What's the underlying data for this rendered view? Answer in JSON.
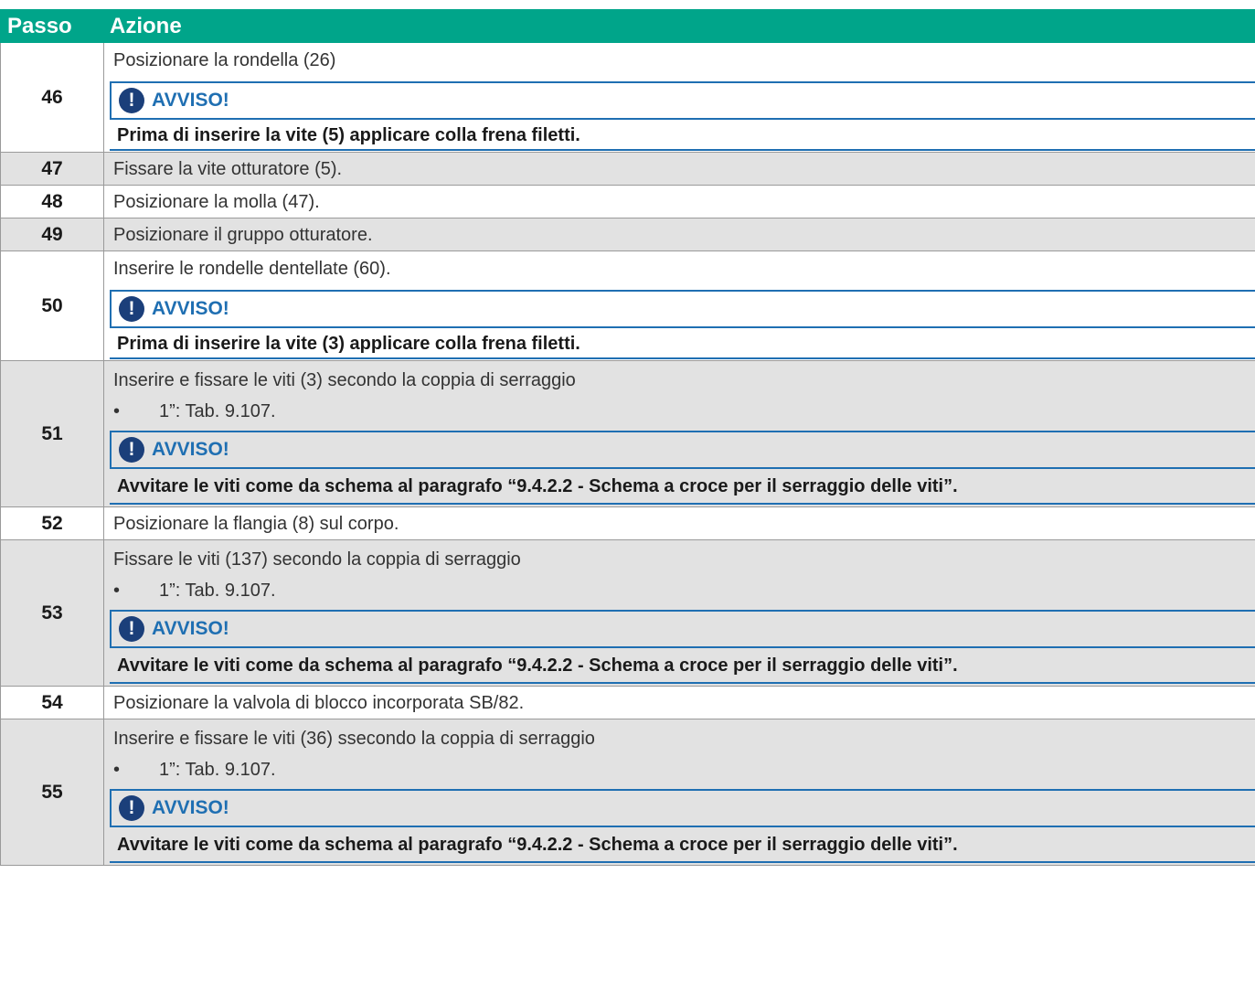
{
  "header": {
    "col_step": "Passo",
    "col_action": "Azione"
  },
  "notice_title": "AVVISO!",
  "notice_icon": "exclamation-icon",
  "bullet_char": "•",
  "rows": [
    {
      "step": "46",
      "lines": [
        "Posizionare la rondella (26)"
      ],
      "bullet": "",
      "warning": "Prima di inserire la vite (5) applicare colla frena filetti."
    },
    {
      "step": "47",
      "lines": [
        "Fissare la vite otturatore (5)."
      ]
    },
    {
      "step": "48",
      "lines": [
        "Posizionare la molla (47)."
      ]
    },
    {
      "step": "49",
      "lines": [
        "Posizionare il gruppo otturatore."
      ]
    },
    {
      "step": "50",
      "lines": [
        "Inserire le rondelle dentellate (60)."
      ],
      "warning": "Prima di inserire la vite (3) applicare colla frena filetti."
    },
    {
      "step": "51",
      "lines": [
        "Inserire e fissare le viti (3) secondo la coppia di serraggio"
      ],
      "bullet": "1”: Tab. 9.107.",
      "warning": "Avvitare le viti come da schema al paragrafo “9.4.2.2  - Schema a croce per il serraggio delle viti”."
    },
    {
      "step": "52",
      "lines": [
        "Posizionare la flangia (8) sul corpo."
      ]
    },
    {
      "step": "53",
      "lines": [
        "Fissare le viti (137) secondo la coppia di serraggio"
      ],
      "bullet": "1”: Tab. 9.107.",
      "warning": "Avvitare le viti come da schema al paragrafo “9.4.2.2  - Schema a croce per il serraggio delle viti”."
    },
    {
      "step": "54",
      "lines": [
        "Posizionare la valvola di blocco incorporata SB/82."
      ]
    },
    {
      "step": "55",
      "lines": [
        "Inserire e fissare le viti (36) ssecondo la coppia di serraggio"
      ],
      "bullet": "1”: Tab. 9.107.",
      "warning": "Avvitare le viti come da schema al paragrafo “9.4.2.2  - Schema a croce per il serraggio delle viti”."
    }
  ]
}
